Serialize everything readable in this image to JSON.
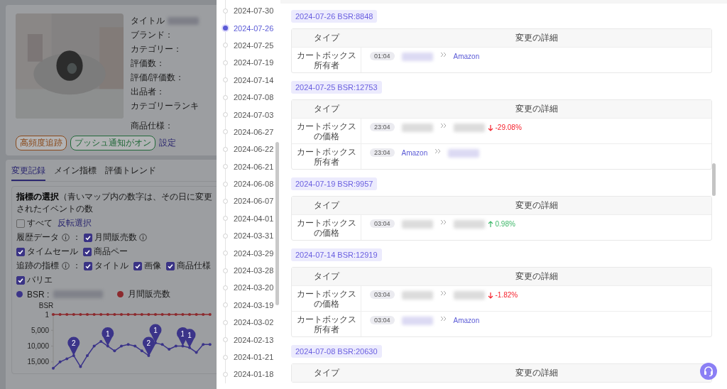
{
  "product": {
    "fields": [
      {
        "label": "タイトル",
        "redacted": true
      },
      {
        "label": "ブランド："
      },
      {
        "label": "カテゴリー："
      },
      {
        "label": "評価数："
      },
      {
        "label": "評価/評価数："
      },
      {
        "label": "出品者："
      },
      {
        "label": "カテゴリーランキ"
      },
      {
        "label": "商品仕様："
      }
    ],
    "tags": [
      {
        "text": "高頻度追跡",
        "color": "#8a4a1c"
      },
      {
        "text": "プッシュ通知がオン",
        "color": "#22693a"
      }
    ],
    "settings_link": "設定"
  },
  "tabs": [
    {
      "label": "変更記録",
      "selected": true
    },
    {
      "label": "メイン指標",
      "selected": false
    },
    {
      "label": "評価トレンド",
      "selected": false
    }
  ],
  "filter": {
    "note": "**指標の選択**（青いマップ内の数字は、その日に変更されたイベントの数",
    "select_all": {
      "label": "すべて",
      "checked": false
    },
    "invert_link": "反転選択",
    "groups": [
      {
        "label": "履歴データ",
        "suffix": "：",
        "options": [
          {
            "label": "月間販売数",
            "checked": true,
            "info": true
          },
          {
            "label": "タイムセール",
            "checked": true
          },
          {
            "label": "商品ペー",
            "checked": true
          }
        ]
      },
      {
        "label": "追跡の指標",
        "suffix": "：",
        "options": [
          {
            "label": "タイトル",
            "checked": true
          },
          {
            "label": "画像",
            "checked": true
          },
          {
            "label": "商品仕様",
            "checked": true
          },
          {
            "label": "バリエ",
            "checked": true
          }
        ]
      }
    ]
  },
  "legend": [
    {
      "label": "BSR :",
      "color": "#3b3489",
      "redacted": true
    },
    {
      "label": "月間販売数",
      "color": "#8c2a2e"
    }
  ],
  "chart_data": {
    "type": "line",
    "ylabel": "BSR",
    "ylim": [
      17500,
      1
    ],
    "yticks": [
      {
        "value": 1,
        "label": "1"
      },
      {
        "value": 5000,
        "label": "5,000"
      },
      {
        "value": 10000,
        "label": "10,000"
      },
      {
        "value": 15000,
        "label": "15,000"
      }
    ],
    "series": [
      {
        "color": "#3b3489",
        "values": [
          17000,
          15000,
          14000,
          13000,
          16500,
          13000,
          10000,
          8500,
          10000,
          11500,
          10000,
          9500,
          10000,
          11500,
          13000,
          9000,
          9500,
          11000,
          10000,
          10000,
          10500,
          12000,
          9500,
          9500
        ]
      },
      {
        "color": "#8c2a2e",
        "values": [
          1,
          1,
          1,
          1,
          1,
          1,
          1,
          1,
          1,
          1,
          1,
          1,
          1,
          1,
          1,
          1,
          1,
          1,
          1,
          1,
          1,
          1,
          1,
          1
        ]
      }
    ],
    "value_labels": [
      null,
      null,
      null,
      "2",
      null,
      null,
      null,
      null,
      "1",
      null,
      null,
      null,
      null,
      null,
      "2",
      "1",
      null,
      null,
      null,
      "1",
      "1",
      null,
      null,
      null
    ]
  },
  "timeline": [
    {
      "label": "2024-07-30",
      "selected": false
    },
    {
      "label": "2024-07-26",
      "selected": true
    },
    {
      "label": "2024-07-25",
      "selected": false
    },
    {
      "label": "2024-07-19",
      "selected": false
    },
    {
      "label": "2024-07-14",
      "selected": false
    },
    {
      "label": "2024-07-08",
      "selected": false
    },
    {
      "label": "2024-07-03",
      "selected": false
    },
    {
      "label": "2024-06-27",
      "selected": false
    },
    {
      "label": "2024-06-22",
      "selected": false
    },
    {
      "label": "2024-06-21",
      "selected": false
    },
    {
      "label": "2024-06-08",
      "selected": false
    },
    {
      "label": "2024-06-07",
      "selected": false
    },
    {
      "label": "2024-04-01",
      "selected": false
    },
    {
      "label": "2024-03-31",
      "selected": false
    },
    {
      "label": "2024-03-29",
      "selected": false
    },
    {
      "label": "2024-03-28",
      "selected": false
    },
    {
      "label": "2024-03-20",
      "selected": false
    },
    {
      "label": "2024-03-19",
      "selected": false
    },
    {
      "label": "2024-03-02",
      "selected": false
    },
    {
      "label": "2024-02-13",
      "selected": false
    },
    {
      "label": "2024-01-21",
      "selected": false
    },
    {
      "label": "2024-01-18",
      "selected": false
    }
  ],
  "groups": [
    {
      "title": "2024-07-26 BSR:8848",
      "columns": [
        "タイプ",
        "変更の詳細"
      ],
      "rows": [
        {
          "kind": "owner",
          "type": "カートボックス所有者",
          "time": "01:04",
          "from": {
            "kind": "redacted"
          },
          "to": {
            "kind": "link",
            "text": "Amazon"
          }
        }
      ]
    },
    {
      "title": "2024-07-25 BSR:12753",
      "columns": [
        "タイプ",
        "変更の詳細"
      ],
      "rows": [
        {
          "kind": "price",
          "type": "カートボックスの価格",
          "time": "23:04",
          "from": {
            "kind": "redacted"
          },
          "to": {
            "kind": "redacted"
          },
          "change": {
            "text": "-29.08%",
            "kind": "down"
          }
        },
        {
          "kind": "owner",
          "type": "カートボックス所有者",
          "time": "23:04",
          "from": {
            "kind": "link",
            "text": "Amazon"
          },
          "to": {
            "kind": "redacted"
          }
        }
      ]
    },
    {
      "title": "2024-07-19 BSR:9957",
      "columns": [
        "タイプ",
        "変更の詳細"
      ],
      "rows": [
        {
          "kind": "price",
          "type": "カートボックスの価格",
          "time": "03:04",
          "from": {
            "kind": "redacted"
          },
          "to": {
            "kind": "redacted"
          },
          "change": {
            "text": "0.98%",
            "kind": "up"
          }
        }
      ]
    },
    {
      "title": "2024-07-14 BSR:12919",
      "columns": [
        "タイプ",
        "変更の詳細"
      ],
      "rows": [
        {
          "kind": "price",
          "type": "カートボックスの価格",
          "time": "03:04",
          "from": {
            "kind": "redacted"
          },
          "to": {
            "kind": "redacted"
          },
          "change": {
            "text": "-1.82%",
            "kind": "down"
          }
        },
        {
          "kind": "owner",
          "type": "カートボックス所有者",
          "time": "03:04",
          "from": {
            "kind": "redacted"
          },
          "to": {
            "kind": "link",
            "text": "Amazon"
          }
        }
      ]
    },
    {
      "title": "2024-07-08 BSR:20630",
      "columns": [
        "タイプ",
        "変更の詳細"
      ]
    }
  ]
}
